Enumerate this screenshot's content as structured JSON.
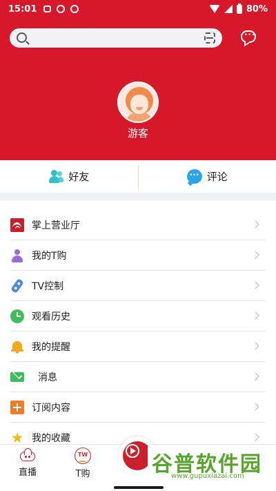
{
  "status_bar": {
    "time": "15:01",
    "battery": "80%"
  },
  "header": {
    "search": {
      "placeholder": ""
    },
    "username": "游客",
    "colors": {
      "brand_red": "#d7182a"
    }
  },
  "social": {
    "friends_label": "好友",
    "comments_label": "评论"
  },
  "menu": {
    "items": [
      {
        "label": "掌上营业厅",
        "icon": "hall-icon"
      },
      {
        "label": "我的T购",
        "icon": "user-icon"
      },
      {
        "label": "TV控制",
        "icon": "remote-icon"
      },
      {
        "label": "观看历史",
        "icon": "clock-icon"
      },
      {
        "label": "我的提醒",
        "icon": "bell-icon"
      },
      {
        "label": "消息",
        "icon": "mail-icon"
      },
      {
        "label": "订阅内容",
        "icon": "subscribe-icon"
      },
      {
        "label": "我的收藏",
        "icon": "star-icon"
      }
    ]
  },
  "tabbar": {
    "tabs": [
      {
        "label": "直播",
        "icon": "live-icon"
      },
      {
        "label": "T购",
        "icon": "tbuy-icon"
      }
    ],
    "center_button_icon": "play-icon"
  },
  "watermark": {
    "title": "谷普软件园",
    "url": "www.gupuxiazai.com"
  }
}
